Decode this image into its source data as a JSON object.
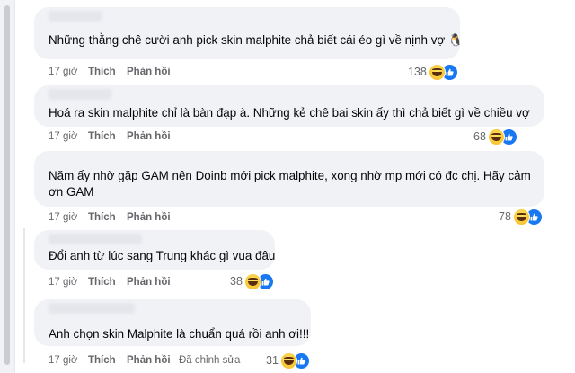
{
  "comments": [
    {
      "text": "Những thằng chê cười anh pick skin malphite chả biết cái éo gì về nịnh vợ 🐧",
      "time": "17 giờ",
      "like": "Thích",
      "reply": "Phản hồi",
      "count": "138"
    },
    {
      "text": "Hoá ra skin malphite chỉ là bàn đạp à. Những kẻ chê bai skin ấy thì chả biết gì về chiều vợ",
      "time": "17 giờ",
      "like": "Thích",
      "reply": "Phản hồi",
      "count": "68"
    },
    {
      "text": "Năm ấy nhờ gặp GAM nên Doinb mới pick malphite, xong nhờ mp mới có đc chị. Hãy cảm ơn GAM",
      "time": "17 giờ",
      "like": "Thích",
      "reply": "Phản hồi",
      "count": "78"
    },
    {
      "text": "Đổi anh từ lúc sang Trung khác gì vua đâu",
      "time": "17 giờ",
      "like": "Thích",
      "reply": "Phản hồi",
      "count": "38"
    },
    {
      "text": "Anh chọn skin Malphite là chuẩn quá rồi anh ơi!!!",
      "time": "17 giờ",
      "like": "Thích",
      "reply": "Phản hồi",
      "edited": "Đã chỉnh sửa",
      "count": "31"
    }
  ],
  "reaction_icons": [
    "haha-icon",
    "like-icon"
  ]
}
